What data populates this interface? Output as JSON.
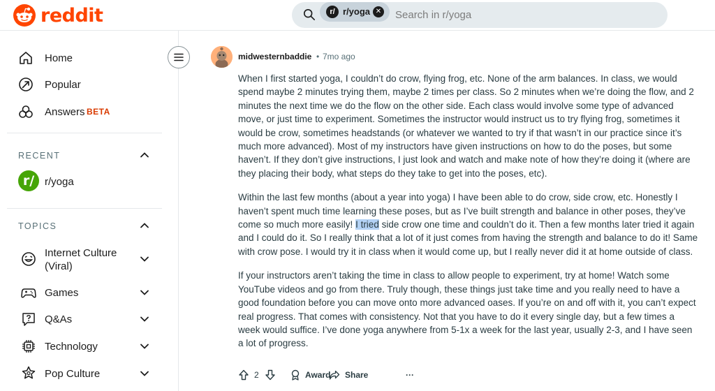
{
  "header": {
    "logo_text": "reddit",
    "search": {
      "chip_label": "r/yoga",
      "chip_avatar": "r/",
      "placeholder": "Search in r/yoga"
    }
  },
  "sidebar": {
    "nav": [
      {
        "label": "Home",
        "icon": "home-icon"
      },
      {
        "label": "Popular",
        "icon": "popular-icon"
      },
      {
        "label": "Answers",
        "icon": "answers-icon",
        "badge": "BETA"
      }
    ],
    "recent": {
      "heading": "RECENT",
      "items": [
        {
          "label": "r/yoga",
          "avatar": "r/"
        }
      ]
    },
    "topics": {
      "heading": "TOPICS",
      "items": [
        {
          "label": "Internet Culture (Viral)",
          "icon": "smile-icon"
        },
        {
          "label": "Games",
          "icon": "gamepad-icon"
        },
        {
          "label": "Q&As",
          "icon": "qa-icon"
        },
        {
          "label": "Technology",
          "icon": "chip-icon"
        },
        {
          "label": "Pop Culture",
          "icon": "star-icon"
        }
      ]
    }
  },
  "comment": {
    "author": "midwesternbaddie",
    "separator": "•",
    "time": "7mo ago",
    "paragraphs": {
      "p1": "When I first started yoga, I couldn’t do crow, flying frog, etc. None of the arm balances. In class, we would spend maybe 2 minutes trying them, maybe 2 times per class. So 2 minutes when we’re doing the flow, and 2 minutes the next time we do the flow on the other side. Each class would involve some type of advanced move, or just time to experiment. Sometimes the instructor would instruct us to try flying frog, sometimes it would be crow, sometimes headstands (or whatever we wanted to try if that wasn’t in our practice since it’s much more advanced). Most of my instructors have given instructions on how to do the poses, but some haven’t. If they don’t give instructions, I just look and watch and make note of how they’re doing it (where are they placing their body, what steps do they take to get into the poses, etc).",
      "p2_before": "Within the last few months (about a year into yoga) I have been able to do crow, side crow, etc. Honestly I haven’t spent much time learning these poses, but as I’ve built strength and balance in other poses, they’ve come so much more easily! ",
      "p2_highlight": "I tried",
      "p2_after": " side crow one time and couldn’t do it. Then a few months later tried it again and I could do it. So I really think that a lot of it just comes from having the strength and balance to do it! Same with crow pose. I would try it in class when it would come up, but I really never did it at home outside of class.",
      "p3": "If your instructors aren’t taking the time in class to allow people to experiment, try at home! Watch some YouTube videos and go from there. Truly though, these things just take time and you really need to have a good foundation before you can move onto more advanced oases. If you’re on and off with it, you can’t expect real progress. That comes with consistency. Not that you have to do it every single day, but a few times a week would suffice. I’ve done yoga anywhere from 5-1x a week for the last year, usually 2-3, and I have seen a lot of progress."
    },
    "actions": {
      "vote_count": "2",
      "award_label": "Award",
      "share_label": "Share",
      "more_label": "···"
    }
  },
  "colors": {
    "brand": "#ff4500",
    "beta": "#d93a00",
    "recent_avatar": "#46a508",
    "selection": "#b3d2f5"
  }
}
